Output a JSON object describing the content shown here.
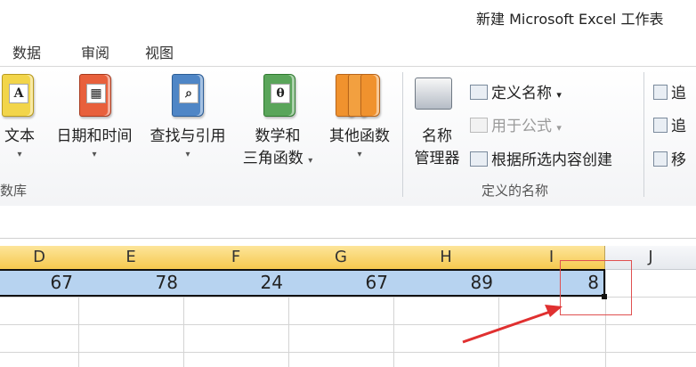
{
  "title": "新建 Microsoft Excel 工作表",
  "tabs": [
    "数据",
    "审阅",
    "视图"
  ],
  "ribbon": {
    "function_library": {
      "buttons": [
        {
          "line1": "文本",
          "line2": "",
          "icon": "text-book-icon",
          "color": "#f2d54a",
          "glyph": "A"
        },
        {
          "line1": "日期和时间",
          "line2": "",
          "icon": "calendar-book-icon",
          "color": "#e8603c",
          "glyph": "▦"
        },
        {
          "line1": "查找与引用",
          "line2": "",
          "icon": "lookup-book-icon",
          "color": "#4f86c6",
          "glyph": "⌕"
        },
        {
          "line1": "数学和",
          "line2": "三角函数",
          "icon": "math-book-icon",
          "color": "#5aa55a",
          "glyph": "θ"
        },
        {
          "line1": "其他函数",
          "line2": "",
          "icon": "more-books-icon",
          "color": "#f0922e",
          "glyph": ""
        }
      ],
      "label": "数库",
      "dropdown_glyph": "▾"
    },
    "defined_names": {
      "name_manager_line1": "名称",
      "name_manager_line2": "管理器",
      "define_name": "定义名称",
      "use_in_formula": "用于公式",
      "create_from_selection": "根据所选内容创建",
      "label": "定义的名称"
    },
    "auditing": {
      "items": [
        "追",
        "追",
        "移"
      ]
    }
  },
  "sheet": {
    "columns": [
      "D",
      "E",
      "F",
      "G",
      "H",
      "I",
      "J"
    ],
    "row_values": [
      "67",
      "78",
      "24",
      "67",
      "89",
      "8"
    ]
  },
  "colors": {
    "selection_fill": "#b7d3f0",
    "header_selected": "#f6c94f",
    "annotation_red": "#e03030"
  }
}
